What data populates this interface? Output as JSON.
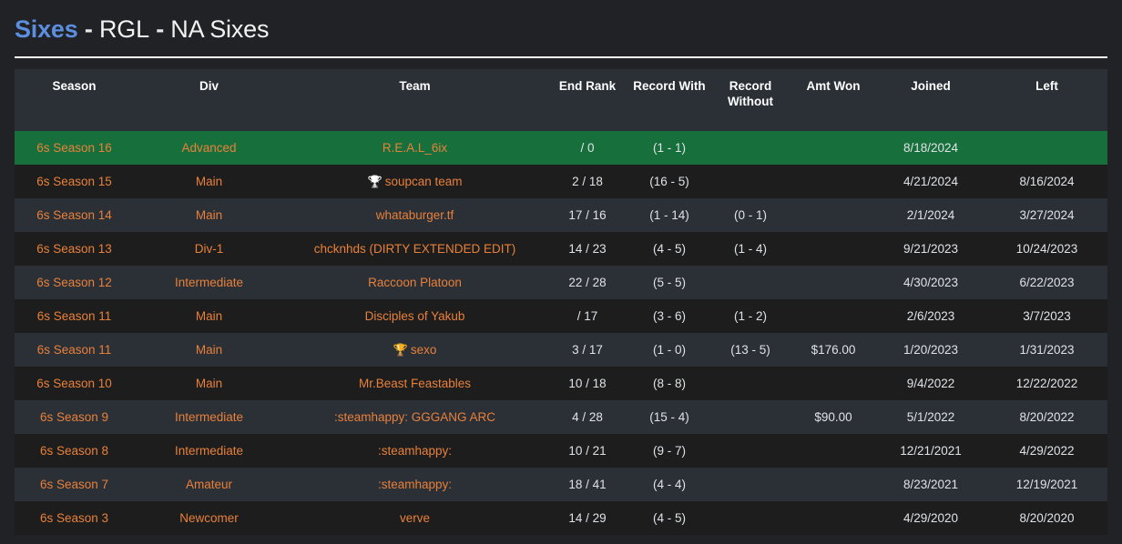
{
  "header": {
    "brand": "Sixes",
    "separator_1": " - ",
    "league": "RGL",
    "separator_2": " - ",
    "region_format": "NA Sixes",
    "brand_color": "#5b8ede"
  },
  "table": {
    "columns": [
      {
        "key": "season",
        "label": "Season"
      },
      {
        "key": "div",
        "label": "Div"
      },
      {
        "key": "team",
        "label": "Team"
      },
      {
        "key": "rank",
        "label": "End Rank"
      },
      {
        "key": "rw",
        "label": "Record With"
      },
      {
        "key": "rwo",
        "label": "Record Without"
      },
      {
        "key": "amt",
        "label": "Amt Won"
      },
      {
        "key": "joined",
        "label": "Joined"
      },
      {
        "key": "left",
        "label": "Left"
      }
    ],
    "rows": [
      {
        "season": "6s Season 16",
        "div": "Advanced",
        "team": "R.E.A.L_6ix",
        "trophy": "",
        "rank": "/ 0",
        "rw": "(1 - 1)",
        "rwo": "",
        "amt": "",
        "joined": "8/18/2024",
        "left": "",
        "highlighted": true
      },
      {
        "season": "6s Season 15",
        "div": "Main",
        "team": "soupcan team",
        "trophy": "silver",
        "rank": "2 / 18",
        "rw": "(16 - 5)",
        "rwo": "",
        "amt": "",
        "joined": "4/21/2024",
        "left": "8/16/2024",
        "highlighted": false
      },
      {
        "season": "6s Season 14",
        "div": "Main",
        "team": "whataburger.tf",
        "trophy": "",
        "rank": "17 / 16",
        "rw": "(1 - 14)",
        "rwo": "(0 - 1)",
        "amt": "",
        "joined": "2/1/2024",
        "left": "3/27/2024",
        "highlighted": false
      },
      {
        "season": "6s Season 13",
        "div": "Div-1",
        "team": "chcknhds (DIRTY EXTENDED EDIT)",
        "trophy": "",
        "rank": "14 / 23",
        "rw": "(4 - 5)",
        "rwo": "(1 - 4)",
        "amt": "",
        "joined": "9/21/2023",
        "left": "10/24/2023",
        "highlighted": false
      },
      {
        "season": "6s Season 12",
        "div": "Intermediate",
        "team": "Raccoon Platoon",
        "trophy": "",
        "rank": "22 / 28",
        "rw": "(5 - 5)",
        "rwo": "",
        "amt": "",
        "joined": "4/30/2023",
        "left": "6/22/2023",
        "highlighted": false
      },
      {
        "season": "6s Season 11",
        "div": "Main",
        "team": "Disciples of Yakub",
        "trophy": "",
        "rank": "/ 17",
        "rw": "(3 - 6)",
        "rwo": "(1 - 2)",
        "amt": "",
        "joined": "2/6/2023",
        "left": "3/7/2023",
        "highlighted": false
      },
      {
        "season": "6s Season 11",
        "div": "Main",
        "team": "sexo",
        "trophy": "gold",
        "rank": "3 / 17",
        "rw": "(1 - 0)",
        "rwo": "(13 - 5)",
        "amt": "$176.00",
        "joined": "1/20/2023",
        "left": "1/31/2023",
        "highlighted": false
      },
      {
        "season": "6s Season 10",
        "div": "Main",
        "team": "Mr.Beast Feastables",
        "trophy": "",
        "rank": "10 / 18",
        "rw": "(8 - 8)",
        "rwo": "",
        "amt": "",
        "joined": "9/4/2022",
        "left": "12/22/2022",
        "highlighted": false
      },
      {
        "season": "6s Season 9",
        "div": "Intermediate",
        "team": ":steamhappy: GGGANG ARC",
        "trophy": "",
        "rank": "4 / 28",
        "rw": "(15 - 4)",
        "rwo": "",
        "amt": "$90.00",
        "joined": "5/1/2022",
        "left": "8/20/2022",
        "highlighted": false
      },
      {
        "season": "6s Season 8",
        "div": "Intermediate",
        "team": ":steamhappy:",
        "trophy": "",
        "rank": "10 / 21",
        "rw": "(9 - 7)",
        "rwo": "",
        "amt": "",
        "joined": "12/21/2021",
        "left": "4/29/2022",
        "highlighted": false
      },
      {
        "season": "6s Season 7",
        "div": "Amateur",
        "team": ":steamhappy:",
        "trophy": "",
        "rank": "18 / 41",
        "rw": "(4 - 4)",
        "rwo": "",
        "amt": "",
        "joined": "8/23/2021",
        "left": "12/19/2021",
        "highlighted": false
      },
      {
        "season": "6s Season 3",
        "div": "Newcomer",
        "team": "verve",
        "trophy": "",
        "rank": "14 / 29",
        "rw": "(4 - 5)",
        "rwo": "",
        "amt": "",
        "joined": "4/29/2020",
        "left": "8/20/2020",
        "highlighted": false
      }
    ]
  },
  "colors": {
    "page_background": "#202225",
    "row_dark": "#1d1d1d",
    "row_light": "#2b2f36",
    "row_highlight": "#17703c",
    "link_orange": "#e8803a",
    "money_green": "#2fa84f",
    "header_text": "#ffffff"
  }
}
